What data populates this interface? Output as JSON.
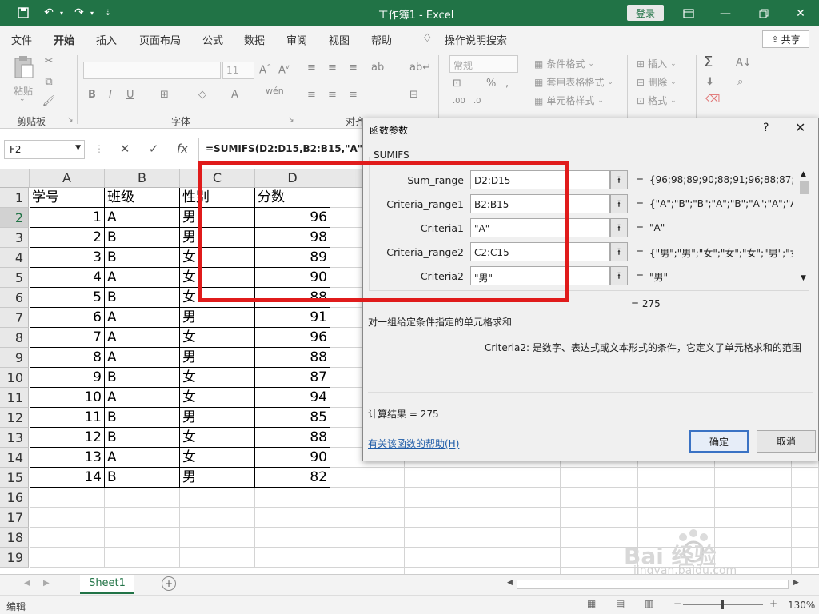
{
  "titlebar": {
    "title": "工作簿1  -  Excel",
    "login_label": "登录",
    "save_icon": "save-icon",
    "undo_icon": "undo-icon",
    "redo_icon": "redo-icon"
  },
  "tabs": {
    "items": [
      "文件",
      "开始",
      "插入",
      "页面布局",
      "公式",
      "数据",
      "审阅",
      "视图",
      "帮助"
    ],
    "active": "开始",
    "tell_me": "操作说明搜索",
    "share": "共享"
  },
  "ribbon": {
    "clipboard_label": "剪贴板",
    "paste_label": "粘贴",
    "font_label": "字体",
    "align_label": "对齐",
    "font_size": "11",
    "number_format": "常规",
    "conditional_format": "条件格式",
    "table_format": "套用表格格式",
    "cell_styles": "单元格样式",
    "insert": "插入",
    "delete": "删除",
    "format": "格式"
  },
  "formula_bar": {
    "name_box": "F2",
    "formula": "=SUMIFS(D2:D15,B2:B15,\"A\",C2"
  },
  "sheet": {
    "columns": [
      "A",
      "B",
      "C",
      "D"
    ],
    "header_row": [
      "学号",
      "班级",
      "性别",
      "分数"
    ],
    "rows": [
      [
        "1",
        "A",
        "男",
        "96"
      ],
      [
        "2",
        "B",
        "男",
        "98"
      ],
      [
        "3",
        "B",
        "女",
        "89"
      ],
      [
        "4",
        "A",
        "女",
        "90"
      ],
      [
        "5",
        "B",
        "女",
        "88"
      ],
      [
        "6",
        "A",
        "男",
        "91"
      ],
      [
        "7",
        "A",
        "女",
        "96"
      ],
      [
        "8",
        "A",
        "男",
        "88"
      ],
      [
        "9",
        "B",
        "女",
        "87"
      ],
      [
        "10",
        "A",
        "女",
        "94"
      ],
      [
        "11",
        "B",
        "男",
        "85"
      ],
      [
        "12",
        "B",
        "女",
        "88"
      ],
      [
        "13",
        "A",
        "女",
        "90"
      ],
      [
        "14",
        "B",
        "男",
        "82"
      ]
    ],
    "row_numbers": [
      "1",
      "2",
      "3",
      "4",
      "5",
      "6",
      "7",
      "8",
      "9",
      "10",
      "11",
      "12",
      "13",
      "14",
      "15",
      "16",
      "17",
      "18",
      "19"
    ],
    "sheet_tab": "Sheet1"
  },
  "status": {
    "mode": "编辑",
    "zoom": "130%"
  },
  "dialog": {
    "title": "函数参数",
    "help_glyph": "?",
    "function_name": "SUMIFS",
    "args": [
      {
        "label": "Sum_range",
        "value": "D2:D15",
        "result": "{96;98;89;90;88;91;96;88;87;94..."
      },
      {
        "label": "Criteria_range1",
        "value": "B2:B15",
        "result": "{\"A\";\"B\";\"B\";\"A\";\"B\";\"A\";\"A\";\"A\"..."
      },
      {
        "label": "Criteria1",
        "value": "\"A\"",
        "result": "\"A\""
      },
      {
        "label": "Criteria_range2",
        "value": "C2:C15",
        "result": "{\"男\";\"男\";\"女\";\"女\";\"女\";\"男\";\"女\";"
      },
      {
        "label": "Criteria2",
        "value": "\"男\"",
        "result": "\"男\""
      }
    ],
    "total_result": "=  275",
    "description": "对一组给定条件指定的单元格求和",
    "arg_help": "Criteria2:  是数字、表达式或文本形式的条件，它定义了单元格求和的范围",
    "calc_result": "计算结果 =   275",
    "help_link": "有关该函数的帮助(H)",
    "ok_label": "确定",
    "cancel_label": "取消"
  },
  "watermark": {
    "brand": "Bai 经验",
    "url": "jingyan.baidu.com"
  }
}
